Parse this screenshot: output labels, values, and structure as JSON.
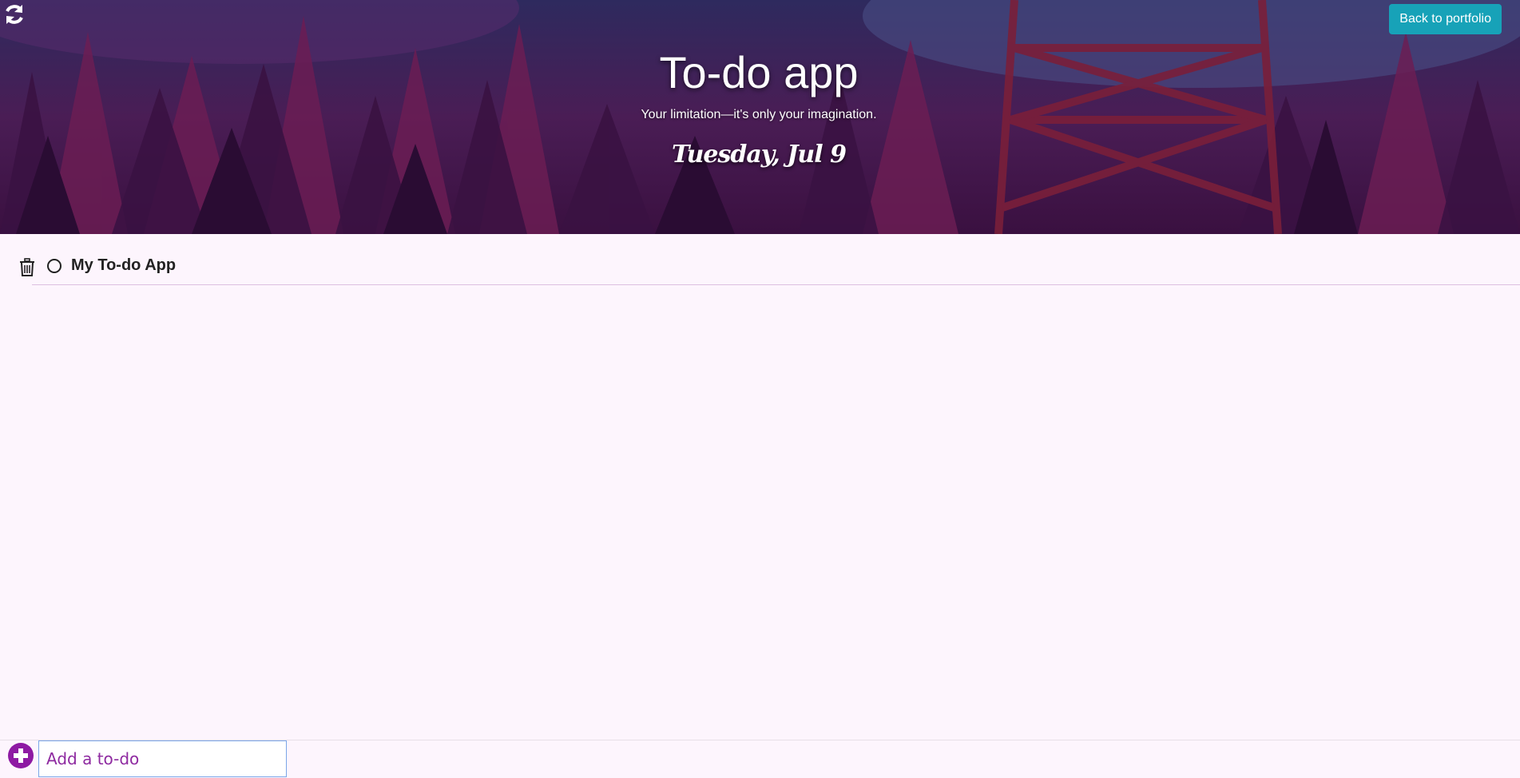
{
  "header": {
    "title": "To-do app",
    "subtitle": "Your limitation—it's only your imagination.",
    "date": "Tuesday, Jul 9",
    "back_button_label": "Back to portfolio",
    "refresh_icon": "refresh-icon"
  },
  "todos": [
    {
      "text": "My To-do App",
      "completed": false,
      "delete_icon": "trash-icon"
    }
  ],
  "footer": {
    "add_icon": "plus-circle-icon",
    "input_placeholder": "Add a to-do",
    "input_value": ""
  },
  "colors": {
    "accent": "#8e1aa3",
    "button": "#17a2b8",
    "background": "#fdf5fd"
  }
}
